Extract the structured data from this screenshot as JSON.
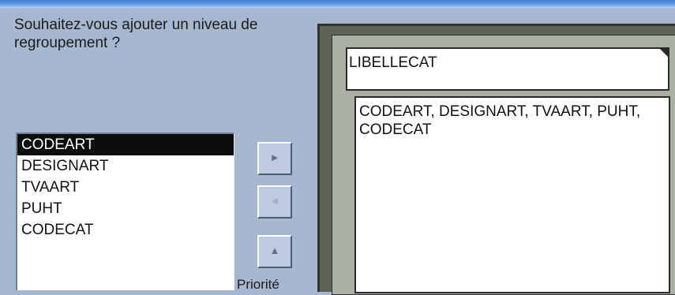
{
  "window": {
    "title_bar_color": "#3a7bd5"
  },
  "question": "Souhaitez-vous ajouter un niveau de regroupement ?",
  "fields": [
    {
      "label": "CODEART",
      "selected": true
    },
    {
      "label": "DESIGNART",
      "selected": false
    },
    {
      "label": "TVAART",
      "selected": false
    },
    {
      "label": "PUHT",
      "selected": false
    },
    {
      "label": "CODECAT",
      "selected": false
    }
  ],
  "buttons": {
    "add": {
      "glyph": "►",
      "icon": "arrow-right-icon",
      "enabled": true
    },
    "remove": {
      "glyph": "◄",
      "icon": "arrow-left-icon",
      "enabled": false
    },
    "priority_up": {
      "glyph": "▲",
      "icon": "arrow-up-icon",
      "enabled": true
    },
    "priority_label": "Priorité"
  },
  "preview": {
    "group_header": "LIBELLECAT",
    "detail_fields": "CODEART, DESIGNART, TVAART, PUHT, CODECAT"
  }
}
